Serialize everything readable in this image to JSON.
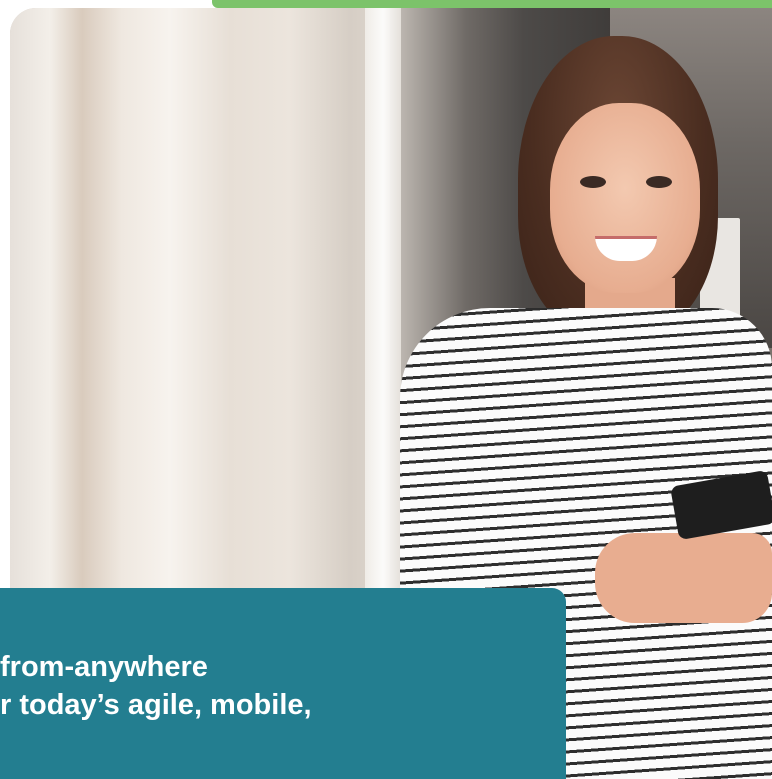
{
  "caption": {
    "line1": "from-anywhere",
    "line2": "r today’s agile, mobile,"
  },
  "colors": {
    "accent_green": "#7cc36a",
    "caption_background": "#237e90",
    "caption_text": "#ffffff"
  },
  "photo": {
    "subject": "smiling woman in striped shirt holding smartphone"
  }
}
